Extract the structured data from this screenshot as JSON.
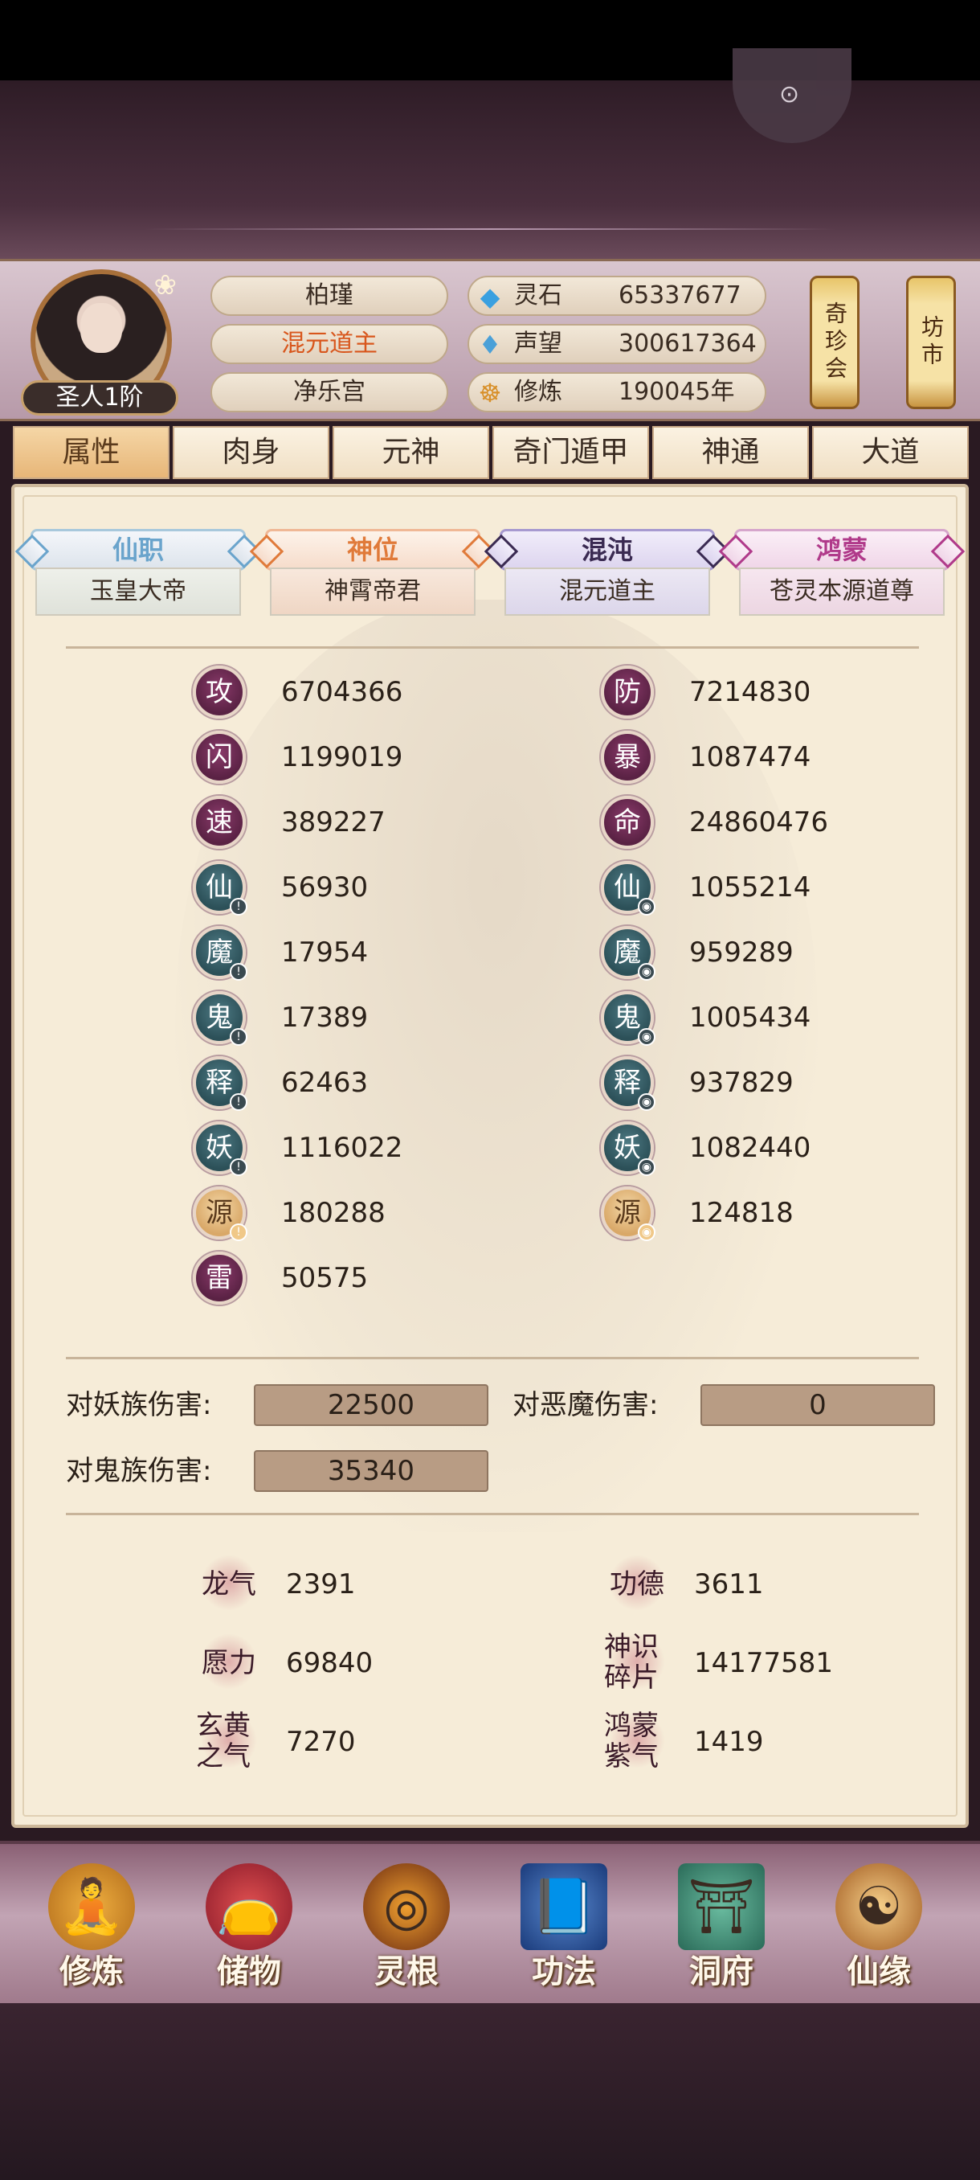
{
  "header": {
    "rank_badge": "圣人1阶",
    "name": "柏瑾",
    "title": "混元道主",
    "sect": "净乐宫",
    "resources": [
      {
        "icon": "spirit-stone-icon",
        "label": "灵石",
        "value": "65337677"
      },
      {
        "icon": "prestige-icon",
        "label": "声望",
        "value": "300617364"
      },
      {
        "icon": "cultivation-icon",
        "label": "修炼",
        "value": "190045年"
      }
    ],
    "shop_buttons": [
      "奇珍会",
      "坊市"
    ]
  },
  "tabs": [
    "属性",
    "肉身",
    "元神",
    "奇门遁甲",
    "神通",
    "大道"
  ],
  "active_tab": "属性",
  "ranks": [
    {
      "head": "仙职",
      "body": "玉皇大帝"
    },
    {
      "head": "神位",
      "body": "神霄帝君"
    },
    {
      "head": "混沌",
      "body": "混元道主"
    },
    {
      "head": "鸿蒙",
      "body": "苍灵本源道尊"
    }
  ],
  "stats_left": [
    {
      "icon": "攻",
      "value": "6704366"
    },
    {
      "icon": "闪",
      "value": "1199019"
    },
    {
      "icon": "速",
      "value": "389227"
    },
    {
      "icon": "仙",
      "value": "56930"
    },
    {
      "icon": "魔",
      "value": "17954"
    },
    {
      "icon": "鬼",
      "value": "17389"
    },
    {
      "icon": "释",
      "value": "62463"
    },
    {
      "icon": "妖",
      "value": "1116022"
    },
    {
      "icon": "源",
      "value": "180288"
    },
    {
      "icon": "雷",
      "value": "50575"
    }
  ],
  "stats_right": [
    {
      "icon": "防",
      "value": "7214830"
    },
    {
      "icon": "暴",
      "value": "1087474"
    },
    {
      "icon": "命",
      "value": "24860476"
    },
    {
      "icon": "仙",
      "value": "1055214"
    },
    {
      "icon": "魔",
      "value": "959289"
    },
    {
      "icon": "鬼",
      "value": "1005434"
    },
    {
      "icon": "释",
      "value": "937829"
    },
    {
      "icon": "妖",
      "value": "1082440"
    },
    {
      "icon": "源",
      "value": "124818"
    }
  ],
  "damage": {
    "yao_label": "对妖族伤害:",
    "yao_value": "22500",
    "demon_label": "对恶魔伤害:",
    "demon_value": "0",
    "ghost_label": "对鬼族伤害:",
    "ghost_value": "35340"
  },
  "misc_left": [
    {
      "label": "龙气",
      "value": "2391"
    },
    {
      "label": "愿力",
      "value": "69840"
    },
    {
      "label": "玄黄之气",
      "value": "7270"
    }
  ],
  "misc_right": [
    {
      "label": "功德",
      "value": "3611"
    },
    {
      "label": "神识碎片",
      "value": "14177581"
    },
    {
      "label": "鸿蒙紫气",
      "value": "1419"
    }
  ],
  "bottom_nav": [
    {
      "label": "修炼",
      "icon": "cultivate-icon"
    },
    {
      "label": "储物",
      "icon": "storage-bag-icon"
    },
    {
      "label": "灵根",
      "icon": "spirit-root-icon"
    },
    {
      "label": "功法",
      "icon": "technique-book-icon"
    },
    {
      "label": "洞府",
      "icon": "cave-mansion-icon"
    },
    {
      "label": "仙缘",
      "icon": "fortune-icon"
    }
  ],
  "colors": {
    "accent_title": "#d8561c",
    "stat_purple": "#5a2244",
    "stat_teal": "#2c5058",
    "stat_gold": "#d9a868"
  }
}
